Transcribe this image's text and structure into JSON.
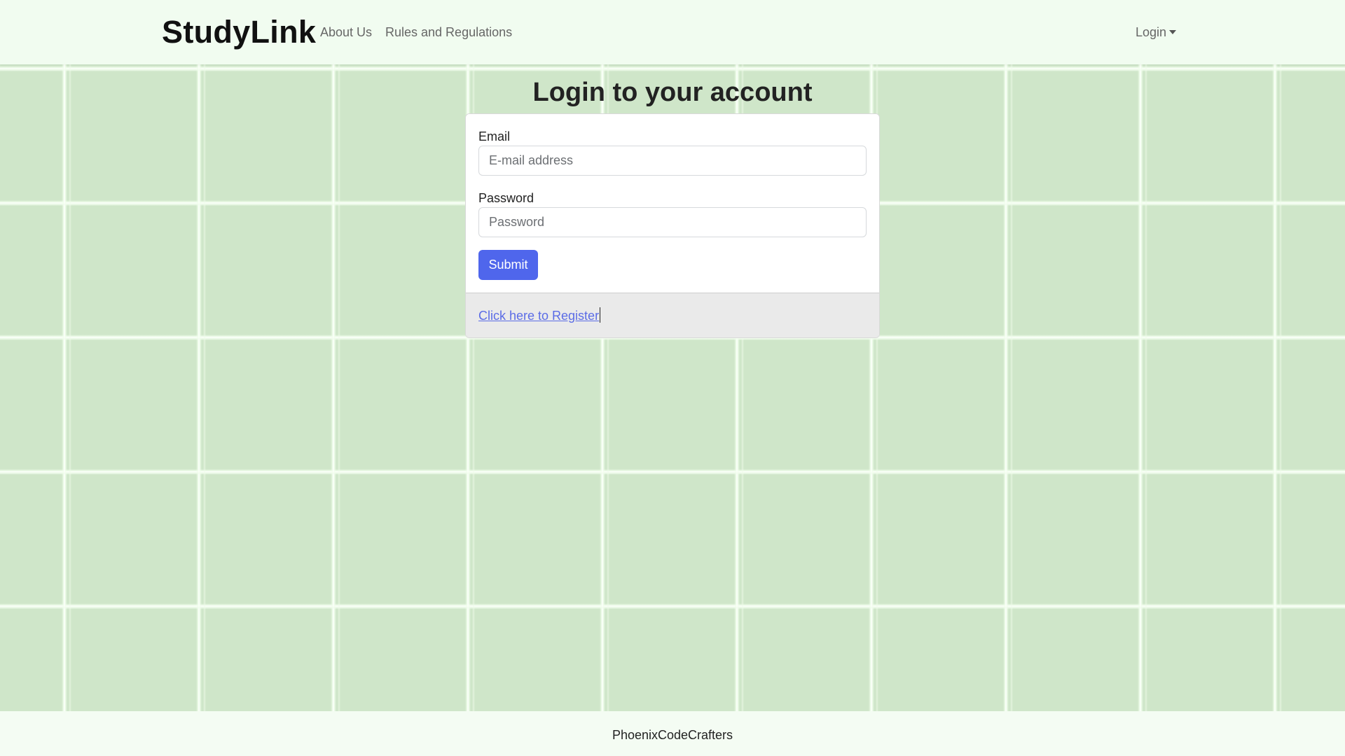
{
  "navbar": {
    "brand": "StudyLink",
    "links": {
      "about": "About Us",
      "rules": "Rules and Regulations"
    },
    "login_dropdown": "Login"
  },
  "main": {
    "title": "Login to your account",
    "form": {
      "email_label": "Email",
      "email_placeholder": "E-mail address",
      "email_value": "",
      "password_label": "Password",
      "password_placeholder": "Password",
      "password_value": "",
      "submit_label": "Submit"
    },
    "register_link": "Click here to Register"
  },
  "footer": {
    "text": "PhoenixCodeCrafters"
  },
  "colors": {
    "background": "#cfe6c9",
    "navbar": "#f1fcf0",
    "primary_button": "#4f66ec",
    "link": "#5b6ce6"
  },
  "icons": {
    "login_caret": "caret-down-icon"
  }
}
